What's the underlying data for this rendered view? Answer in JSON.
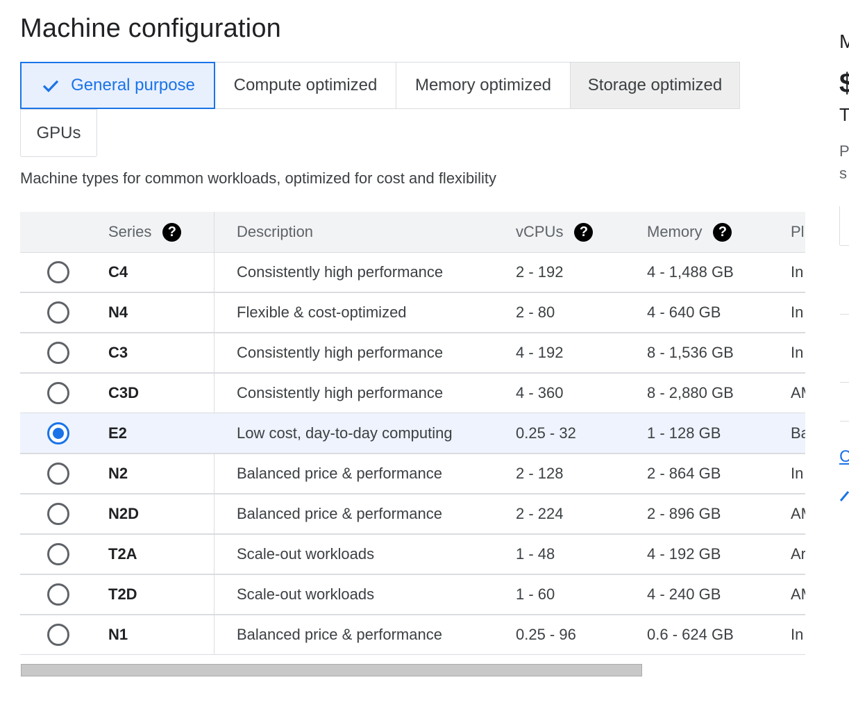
{
  "page": {
    "title": "Machine configuration"
  },
  "tabs": [
    {
      "label": "General purpose",
      "selected": true
    },
    {
      "label": "Compute optimized",
      "selected": false
    },
    {
      "label": "Memory optimized",
      "selected": false
    },
    {
      "label": "Storage optimized",
      "selected": false
    },
    {
      "label": "GPUs",
      "selected": false
    }
  ],
  "description": "Machine types for common workloads, optimized for cost and flexibility",
  "table": {
    "headers": {
      "series": "Series",
      "description": "Description",
      "vcpus": "vCPUs",
      "memory": "Memory",
      "platform": "Pl"
    },
    "help_glyph": "?",
    "rows": [
      {
        "series": "C4",
        "description": "Consistently high performance",
        "vcpus": "2 - 192",
        "memory": "4 - 1,488 GB",
        "platform": "In",
        "selected": false
      },
      {
        "series": "N4",
        "description": "Flexible & cost-optimized",
        "vcpus": "2 - 80",
        "memory": "4 - 640 GB",
        "platform": "In",
        "selected": false
      },
      {
        "series": "C3",
        "description": "Consistently high performance",
        "vcpus": "4 - 192",
        "memory": "8 - 1,536 GB",
        "platform": "In",
        "selected": false
      },
      {
        "series": "C3D",
        "description": "Consistently high performance",
        "vcpus": "4 - 360",
        "memory": "8 - 2,880 GB",
        "platform": "AM",
        "selected": false
      },
      {
        "series": "E2",
        "description": "Low cost, day-to-day computing",
        "vcpus": "0.25 - 32",
        "memory": "1 - 128 GB",
        "platform": "Ba",
        "selected": true
      },
      {
        "series": "N2",
        "description": "Balanced price & performance",
        "vcpus": "2 - 128",
        "memory": "2 - 864 GB",
        "platform": "In",
        "selected": false
      },
      {
        "series": "N2D",
        "description": "Balanced price & performance",
        "vcpus": "2 - 224",
        "memory": "2 - 896 GB",
        "platform": "AM",
        "selected": false
      },
      {
        "series": "T2A",
        "description": "Scale-out workloads",
        "vcpus": "1 - 48",
        "memory": "4 - 192 GB",
        "platform": "Ar",
        "selected": false
      },
      {
        "series": "T2D",
        "description": "Scale-out workloads",
        "vcpus": "1 - 60",
        "memory": "4 - 240 GB",
        "platform": "AM",
        "selected": false
      },
      {
        "series": "N1",
        "description": "Balanced price & performance",
        "vcpus": "0.25 - 96",
        "memory": "0.6 - 624 GB",
        "platform": "In",
        "selected": false
      }
    ]
  },
  "right_panel": {
    "heading": "M",
    "price": "$",
    "line1": "T",
    "line2": "P",
    "line3": "s",
    "link": "C"
  },
  "colors": {
    "accent": "#1a73e8",
    "selected_bg": "#e8f0fe",
    "header_bg": "#f1f3f4"
  }
}
